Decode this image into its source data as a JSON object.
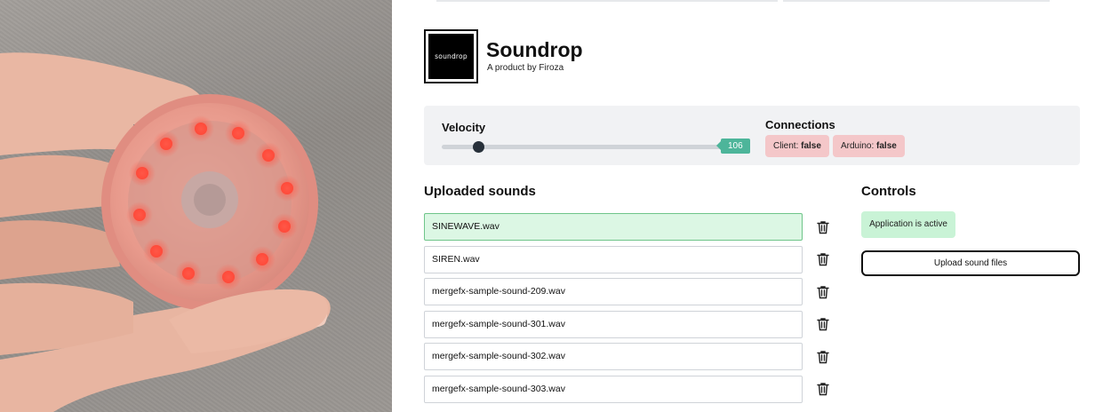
{
  "photo": {
    "alt_icon": "soundrop-device-photo"
  },
  "brand": {
    "logo_text": "soundrop",
    "title": "Soundrop",
    "subtitle": "A product by Firoza"
  },
  "velocity": {
    "label": "Velocity",
    "value": "106",
    "level": 0.13
  },
  "connections": {
    "label": "Connections",
    "client": {
      "name": "Client:",
      "value": "false"
    },
    "arduino": {
      "name": "Arduino:",
      "value": "false"
    }
  },
  "sounds": {
    "heading": "Uploaded sounds",
    "items": [
      "SINEWAVE.wav",
      "SIREN.wav",
      "mergefx-sample-sound-209.wav",
      "mergefx-sample-sound-301.wav",
      "mergefx-sample-sound-302.wav",
      "mergefx-sample-sound-303.wav"
    ],
    "active_index": 0,
    "delete_icon": "trash-icon"
  },
  "controls": {
    "heading": "Controls",
    "status": "Application is active",
    "upload_label": "Upload sound files"
  },
  "colors": {
    "accent": "#4db59a",
    "danger_chip": "#f4c7c9",
    "active_row": "#dcf7e4",
    "status_green": "#c9f3d6"
  }
}
